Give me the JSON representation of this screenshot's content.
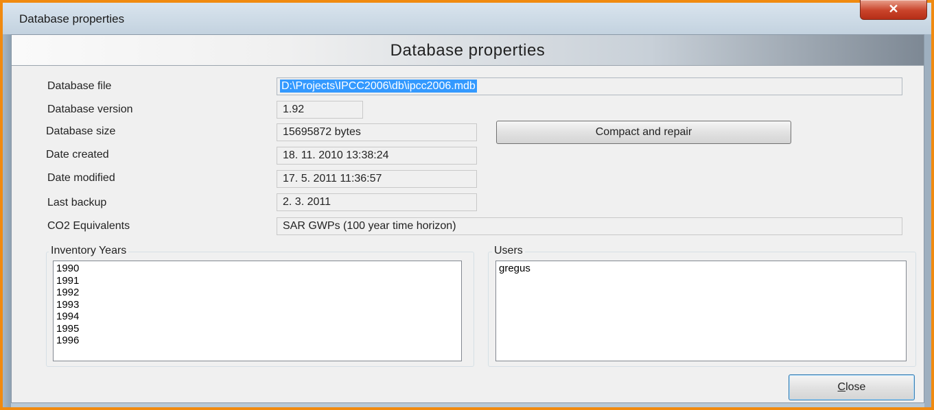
{
  "window": {
    "title": "Database properties",
    "close_glyph": "✕"
  },
  "header": {
    "title": "Database properties"
  },
  "fields": {
    "database_file": {
      "label": "Database file",
      "value": "D:\\Projects\\IPCC2006\\db\\ipcc2006.mdb"
    },
    "database_version": {
      "label": "Database version",
      "value": "1.92"
    },
    "database_size": {
      "label": "Database size",
      "value": "15695872 bytes"
    },
    "date_created": {
      "label": "Date created",
      "value": "18. 11. 2010 13:38:24"
    },
    "date_modified": {
      "label": "Date modified",
      "value": "17. 5. 2011 11:36:57"
    },
    "last_backup": {
      "label": "Last backup",
      "value": "2. 3. 2011"
    },
    "co2_equivalents": {
      "label": "CO2 Equivalents",
      "value": "SAR GWPs (100 year time horizon)"
    }
  },
  "buttons": {
    "compact_repair": "Compact and repair",
    "close_mnemonic": "C",
    "close_rest": "lose"
  },
  "inventory_years": {
    "label": "Inventory Years",
    "items": [
      "1990",
      "1991",
      "1992",
      "1993",
      "1994",
      "1995",
      "1996"
    ]
  },
  "users": {
    "label": "Users",
    "items": [
      "gregus"
    ]
  }
}
